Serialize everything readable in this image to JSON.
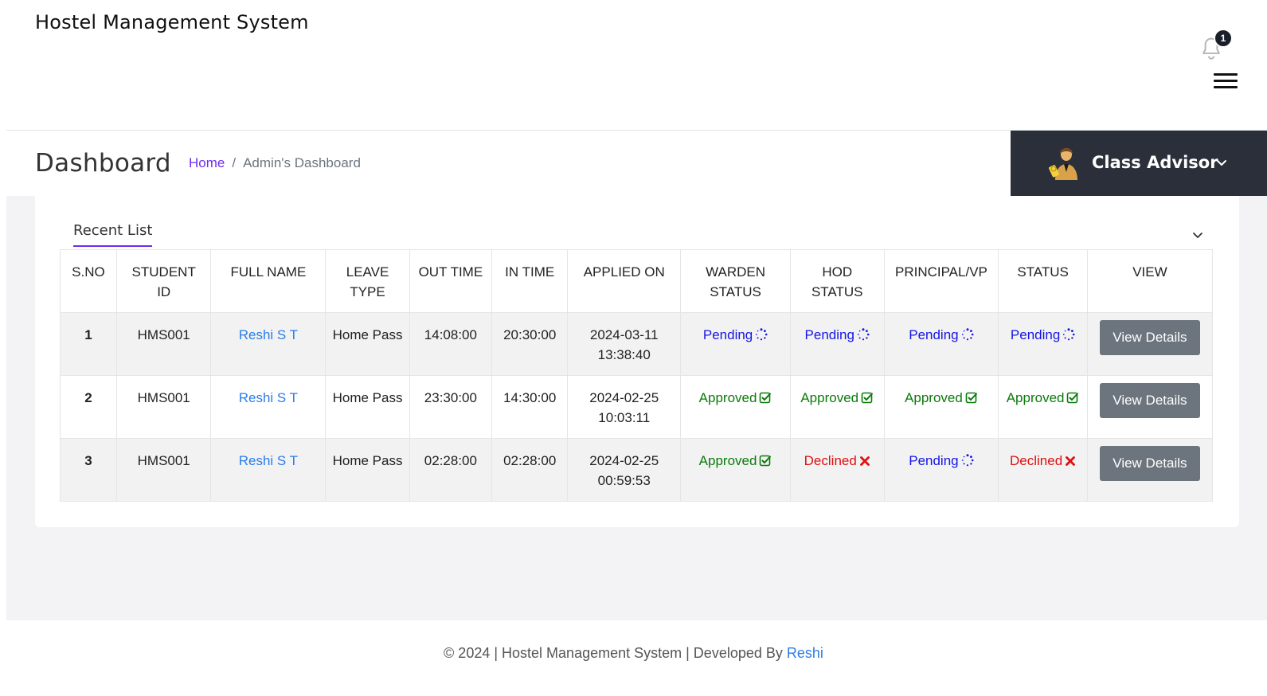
{
  "app": {
    "title": "Hostel Management System"
  },
  "notifications": {
    "count": "1",
    "icon": "bell-icon"
  },
  "menu": {
    "icon": "hamburger-icon"
  },
  "page": {
    "title": "Dashboard",
    "breadcrumb": {
      "home": "Home",
      "separator": "/",
      "current": "Admin's Dashboard"
    }
  },
  "role": {
    "label": "Class Advisor",
    "avatar_icon": "user-avatar-icon",
    "chevron_icon": "chevron-down-icon"
  },
  "card": {
    "tab": "Recent List"
  },
  "table": {
    "headers": [
      "S.NO",
      "STUDENT ID",
      "FULL NAME",
      "LEAVE TYPE",
      "OUT TIME",
      "IN TIME",
      "APPLIED ON",
      "WARDEN STATUS",
      "HOD STATUS",
      "PRINCIPAL/VP",
      "STATUS",
      "VIEW"
    ],
    "rows": [
      {
        "sno": "1",
        "student_id": "HMS001",
        "full_name": "Reshi S T",
        "leave_type": "Home Pass",
        "out_time": "14:08:00",
        "in_time": "20:30:00",
        "applied_on": "2024-03-11 13:38:40",
        "warden": "Pending",
        "hod": "Pending",
        "principal": "Pending",
        "status": "Pending",
        "view": "View Details"
      },
      {
        "sno": "2",
        "student_id": "HMS001",
        "full_name": "Reshi S T",
        "leave_type": "Home Pass",
        "out_time": "23:30:00",
        "in_time": "14:30:00",
        "applied_on": "2024-02-25 10:03:11",
        "warden": "Approved",
        "hod": "Approved",
        "principal": "Approved",
        "status": "Approved",
        "view": "View Details"
      },
      {
        "sno": "3",
        "student_id": "HMS001",
        "full_name": "Reshi S T",
        "leave_type": "Home Pass",
        "out_time": "02:28:00",
        "in_time": "02:28:00",
        "applied_on": "2024-02-25 00:59:53",
        "warden": "Approved",
        "hod": "Declined",
        "principal": "Pending",
        "status": "Declined",
        "view": "View Details"
      }
    ]
  },
  "colors": {
    "accent": "#6f2cf5",
    "pending": "#1515e6",
    "approved": "#0b7a0b",
    "declined": "#e01010",
    "role_bg": "#2a2f3a",
    "button": "#6c757d"
  },
  "footer": {
    "text": "© 2024 | Hostel Management System | Developed By",
    "developer": "Reshi"
  }
}
